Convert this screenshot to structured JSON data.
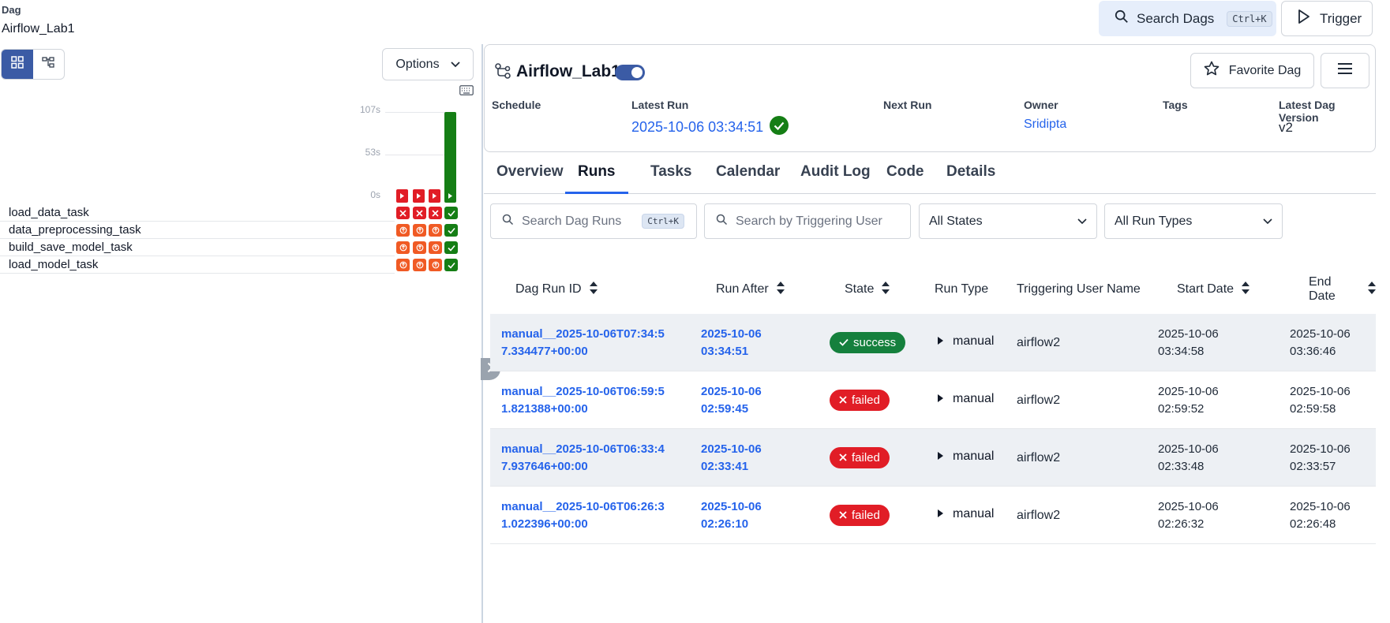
{
  "breadcrumb": {
    "kicker": "Dag",
    "title": "Airflow_Lab1"
  },
  "header": {
    "search_label": "Search Dags",
    "search_shortcut": "Ctrl+K",
    "trigger_label": "Trigger"
  },
  "left_panel": {
    "options_label": "Options",
    "y_axis": [
      "107s",
      "53s",
      "0s"
    ],
    "tasks": [
      "load_data_task",
      "data_preprocessing_task",
      "build_save_model_task",
      "load_model_task"
    ]
  },
  "dag": {
    "name": "Airflow_Lab1",
    "favorite_label": "Favorite Dag",
    "meta": {
      "schedule_label": "Schedule",
      "latest_run_label": "Latest Run",
      "latest_run_value": "2025-10-06 03:34:51",
      "next_run_label": "Next Run",
      "owner_label": "Owner",
      "owner_value": "Sridipta",
      "tags_label": "Tags",
      "version_label": "Latest Dag Version",
      "version_value": "v2"
    }
  },
  "tabs": [
    "Overview",
    "Runs",
    "Tasks",
    "Calendar",
    "Audit Log",
    "Code",
    "Details"
  ],
  "active_tab": "Runs",
  "filters": {
    "search_runs_placeholder": "Search Dag Runs",
    "search_runs_shortcut": "Ctrl+K",
    "search_user_placeholder": "Search by Triggering User",
    "states_value": "All States",
    "run_types_value": "All Run Types"
  },
  "table": {
    "headers": [
      "Dag Run ID",
      "Run After",
      "State",
      "Run Type",
      "Triggering User Name",
      "Start Date",
      "End Date"
    ],
    "rows": [
      {
        "id_l1": "manual__2025-10-06T07:34:5",
        "id_l2": "7.334477+00:00",
        "after_l1": "2025-10-06",
        "after_l2": "03:34:51",
        "state": "success",
        "run_type": "manual",
        "user": "airflow2",
        "start_l1": "2025-10-06",
        "start_l2": "03:34:58",
        "end_l1": "2025-10-06",
        "end_l2": "03:36:46"
      },
      {
        "id_l1": "manual__2025-10-06T06:59:5",
        "id_l2": "1.821388+00:00",
        "after_l1": "2025-10-06",
        "after_l2": "02:59:45",
        "state": "failed",
        "run_type": "manual",
        "user": "airflow2",
        "start_l1": "2025-10-06",
        "start_l2": "02:59:52",
        "end_l1": "2025-10-06",
        "end_l2": "02:59:58"
      },
      {
        "id_l1": "manual__2025-10-06T06:33:4",
        "id_l2": "7.937646+00:00",
        "after_l1": "2025-10-06",
        "after_l2": "02:33:41",
        "state": "failed",
        "run_type": "manual",
        "user": "airflow2",
        "start_l1": "2025-10-06",
        "start_l2": "02:33:48",
        "end_l1": "2025-10-06",
        "end_l2": "02:33:57"
      },
      {
        "id_l1": "manual__2025-10-06T06:26:3",
        "id_l2": "1.022396+00:00",
        "after_l1": "2025-10-06",
        "after_l2": "02:26:10",
        "state": "failed",
        "run_type": "manual",
        "user": "airflow2",
        "start_l1": "2025-10-06",
        "start_l2": "02:26:32",
        "end_l1": "2025-10-06",
        "end_l2": "02:26:48"
      }
    ]
  },
  "colors": {
    "accent": "#2563eb",
    "success": "#15803d",
    "failed": "#e11d26",
    "upstream_failed": "#f05a24",
    "toggle": "#3b5ba5"
  }
}
